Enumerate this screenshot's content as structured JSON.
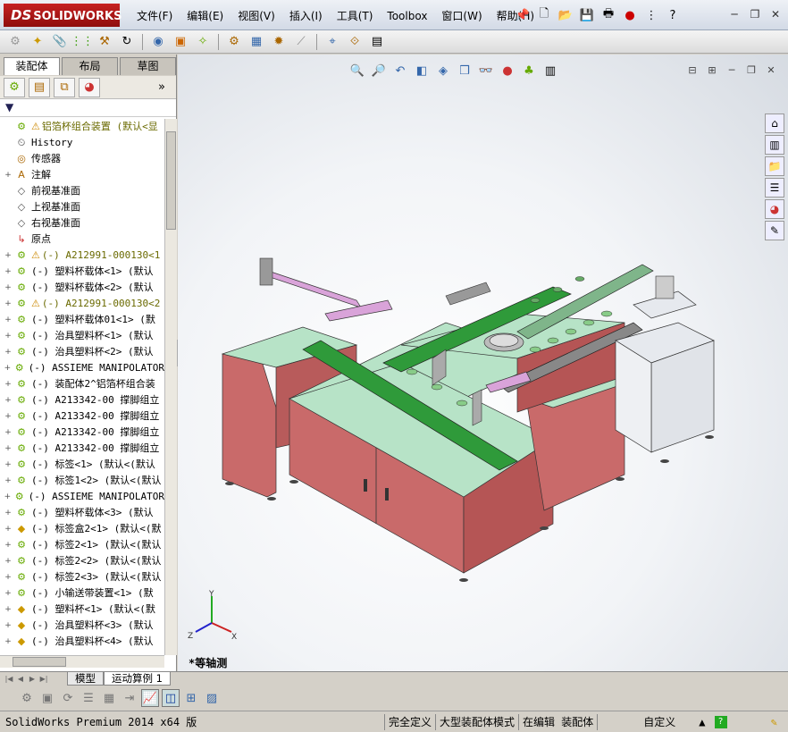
{
  "app": {
    "logo": "SOLIDWORKS",
    "logo_mark": "DS"
  },
  "menu": [
    "文件(F)",
    "编辑(E)",
    "视图(V)",
    "插入(I)",
    "工具(T)",
    "Toolbox",
    "窗口(W)",
    "帮助(H)"
  ],
  "left_tabs": [
    "装配体",
    "布局",
    "草图"
  ],
  "tree": {
    "root": "铝箔杯组合装置 (默认<显",
    "items": [
      {
        "label": "History",
        "icon": "history-icon",
        "exp": ""
      },
      {
        "label": "传感器",
        "icon": "sensor-icon",
        "exp": ""
      },
      {
        "label": "注解",
        "icon": "annotation-icon",
        "exp": "+"
      },
      {
        "label": "前视基准面",
        "icon": "plane-icon",
        "exp": ""
      },
      {
        "label": "上视基准面",
        "icon": "plane-icon",
        "exp": ""
      },
      {
        "label": "右视基准面",
        "icon": "plane-icon",
        "exp": ""
      },
      {
        "label": "原点",
        "icon": "origin-icon",
        "exp": ""
      },
      {
        "label": "(-) A212991-000130<1",
        "icon": "assembly-icon",
        "exp": "+",
        "warn": true
      },
      {
        "label": "(-) 塑料杯载体<1> (默认",
        "icon": "assembly-icon",
        "exp": "+"
      },
      {
        "label": "(-) 塑料杯载体<2> (默认",
        "icon": "assembly-icon",
        "exp": "+"
      },
      {
        "label": "(-) A212991-000130<2",
        "icon": "assembly-icon",
        "exp": "+",
        "warn": true
      },
      {
        "label": "(-) 塑料杯载体01<1> (默",
        "icon": "assembly-icon",
        "exp": "+"
      },
      {
        "label": "(-) 治具塑料杯<1> (默认",
        "icon": "assembly-icon",
        "exp": "+"
      },
      {
        "label": "(-) 治具塑料杯<2> (默认",
        "icon": "assembly-icon",
        "exp": "+"
      },
      {
        "label": "(-) ASSIEME MANIPOLATOR",
        "icon": "assembly-icon",
        "exp": "+"
      },
      {
        "label": "(-) 装配体2^铝箔杯组合装",
        "icon": "assembly-icon",
        "exp": "+"
      },
      {
        "label": "(-) A213342-00 撑脚组立",
        "icon": "assembly-icon",
        "exp": "+"
      },
      {
        "label": "(-) A213342-00 撑脚组立",
        "icon": "assembly-icon",
        "exp": "+"
      },
      {
        "label": "(-) A213342-00 撑脚组立",
        "icon": "assembly-icon",
        "exp": "+"
      },
      {
        "label": "(-) A213342-00 撑脚组立",
        "icon": "assembly-icon",
        "exp": "+"
      },
      {
        "label": "(-) 标签<1> (默认<(默认",
        "icon": "assembly-icon",
        "exp": "+"
      },
      {
        "label": "(-) 标签1<2> (默认<(默认",
        "icon": "assembly-icon",
        "exp": "+"
      },
      {
        "label": "(-) ASSIEME MANIPOLATOR",
        "icon": "assembly-icon",
        "exp": "+"
      },
      {
        "label": "(-) 塑料杯载体<3> (默认",
        "icon": "assembly-icon",
        "exp": "+"
      },
      {
        "label": "(-) 标签盒2<1> (默认<(默",
        "icon": "part-icon",
        "exp": "+"
      },
      {
        "label": "(-) 标签2<1> (默认<(默认",
        "icon": "assembly-icon",
        "exp": "+"
      },
      {
        "label": "(-) 标签2<2> (默认<(默认",
        "icon": "assembly-icon",
        "exp": "+"
      },
      {
        "label": "(-) 标签2<3> (默认<(默认",
        "icon": "assembly-icon",
        "exp": "+"
      },
      {
        "label": "(-) 小输送带装置<1> (默",
        "icon": "assembly-icon",
        "exp": "+"
      },
      {
        "label": "(-) 塑料杯<1> (默认<(默",
        "icon": "part-icon",
        "exp": "+"
      },
      {
        "label": "(-) 治具塑料杯<3> (默认",
        "icon": "part-icon",
        "exp": "+"
      },
      {
        "label": "(-) 治具塑料杯<4> (默认",
        "icon": "part-icon",
        "exp": "+"
      }
    ]
  },
  "view_name": "*等轴测",
  "bottom_tabs": [
    "模型",
    "运动算例 1"
  ],
  "status": {
    "product": "SolidWorks Premium 2014 x64 版",
    "cells": [
      "完全定义",
      "大型装配体模式",
      "在编辑 装配体",
      "自定义"
    ]
  },
  "triad": {
    "x": "X",
    "y": "Y",
    "z": "Z"
  }
}
